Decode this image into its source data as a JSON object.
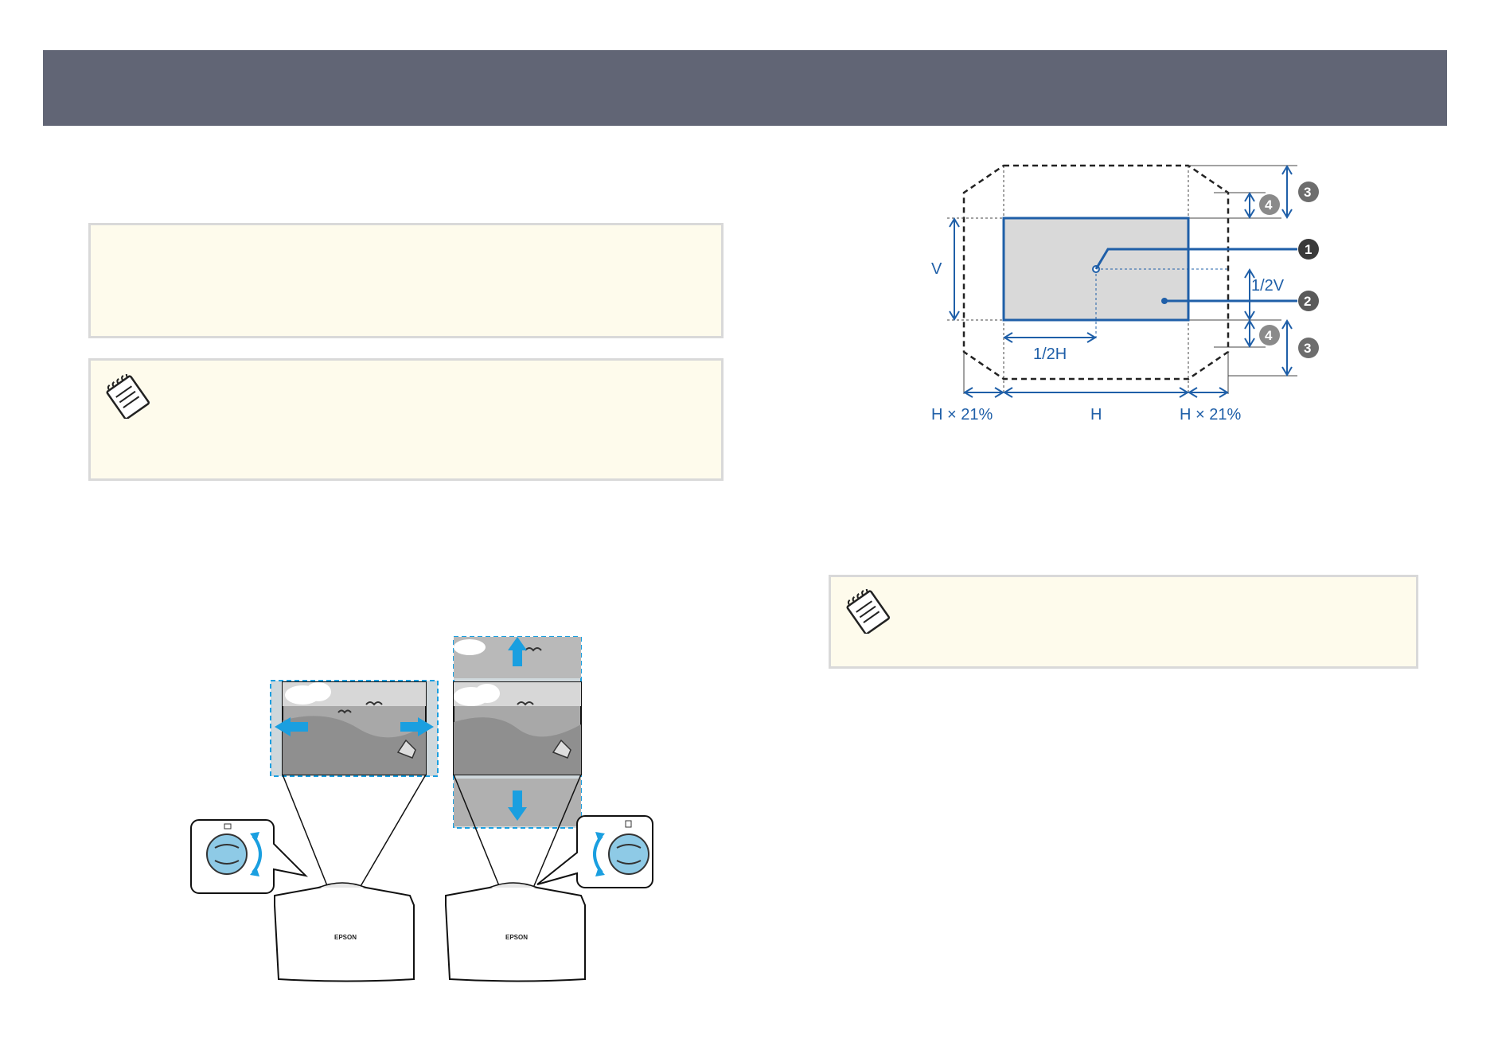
{
  "diagram": {
    "labels": {
      "v": "V",
      "half_v": "1/2V",
      "half_h": "1/2H",
      "h": "H",
      "h21_left": "H × 21%",
      "h21_right": "H × 21%"
    },
    "callouts": [
      "1",
      "2",
      "3",
      "4"
    ]
  },
  "projector": {
    "brand": "EPSON"
  },
  "icons": {
    "note": "notepad-icon",
    "horizontal_dial": "horizontal-lens-shift-dial-icon",
    "vertical_dial": "vertical-lens-shift-dial-icon"
  },
  "colors": {
    "header": "#616575",
    "note_background": "#fefbec",
    "arrow": "#1a9fe0",
    "diagram_blue": "#1f5fa8"
  }
}
